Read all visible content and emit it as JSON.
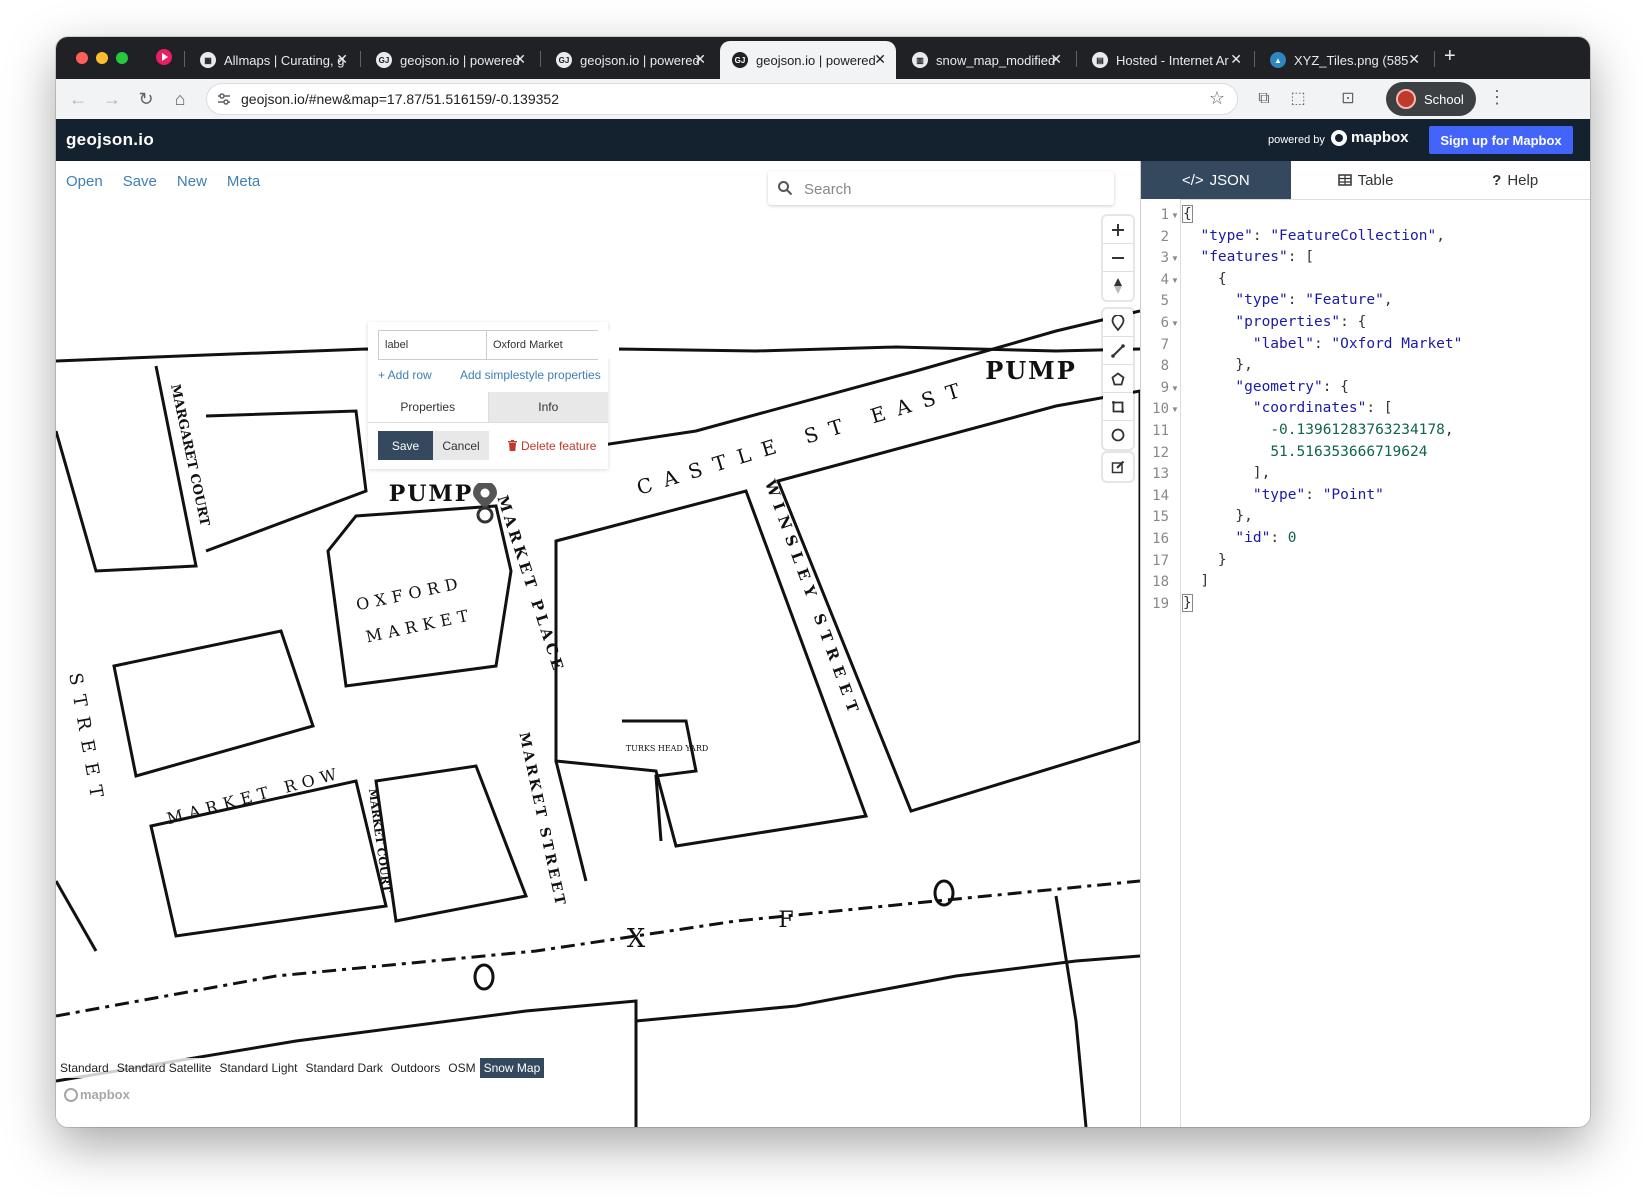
{
  "browser": {
    "tabs": [
      {
        "title": "Allmaps | Curating, g",
        "icon": "allmaps-icon"
      },
      {
        "title": "geojson.io | powered",
        "icon": "geojson-icon"
      },
      {
        "title": "geojson.io | powered",
        "icon": "geojson-icon"
      },
      {
        "title": "geojson.io | powered",
        "icon": "geojson-icon",
        "active": true
      },
      {
        "title": "snow_map_modified",
        "icon": "museum-icon"
      },
      {
        "title": "Hosted - Internet Ar",
        "icon": "archive-icon"
      },
      {
        "title": "XYZ_Tiles.png (585",
        "icon": "image-icon"
      }
    ],
    "url": "geojson.io/#new&map=17.87/51.516159/-0.139352",
    "profile_label": "School"
  },
  "app": {
    "brand": "geojson.io",
    "powered_by": "powered by",
    "mapbox": "mapbox",
    "signup": "Sign up for Mapbox",
    "menu": [
      "Open",
      "Save",
      "New",
      "Meta"
    ],
    "search_placeholder": "Search"
  },
  "popup": {
    "key": "label",
    "value": "Oxford Market",
    "add_row": "+ Add row",
    "add_simplestyle": "Add simplestyle properties",
    "tab_properties": "Properties",
    "tab_info": "Info",
    "save": "Save",
    "cancel": "Cancel",
    "delete": "Delete feature"
  },
  "map_labels": {
    "margaret_court": "MARGARET COURT",
    "pump_left": "PUMP",
    "pump_right": "PUMP",
    "castle_st_east": "CASTLE ST EAST",
    "oxford": "OXFORD",
    "market": "MARKET",
    "market_place": "MARKET PLACE",
    "winsley_street": "WINSLEY STREET",
    "market_row": "MARKET ROW",
    "market_court": "MARKET COURT",
    "market_street": "MARKET STREET",
    "turks_head_yard": "TURKS HEAD YARD",
    "street_left": "STREET",
    "x": "X",
    "f": "F"
  },
  "map_styles": [
    "Standard",
    "Standard Satellite",
    "Standard Light",
    "Standard Dark",
    "Outdoors",
    "OSM",
    "Snow Map"
  ],
  "active_style": "Snow Map",
  "attribution": "mapbox",
  "panel": {
    "tabs": [
      "JSON",
      "Table",
      "Help"
    ],
    "active_tab": "JSON",
    "code_lines": [
      "{",
      "  \"type\": \"FeatureCollection\",",
      "  \"features\": [",
      "    {",
      "      \"type\": \"Feature\",",
      "      \"properties\": {",
      "        \"label\": \"Oxford Market\"",
      "      },",
      "      \"geometry\": {",
      "        \"coordinates\": [",
      "          -0.13961283763234178,",
      "          51.516353666719624",
      "        ],",
      "        \"type\": \"Point\"",
      "      },",
      "      \"id\": 0",
      "    }",
      "  ]",
      "}"
    ]
  }
}
